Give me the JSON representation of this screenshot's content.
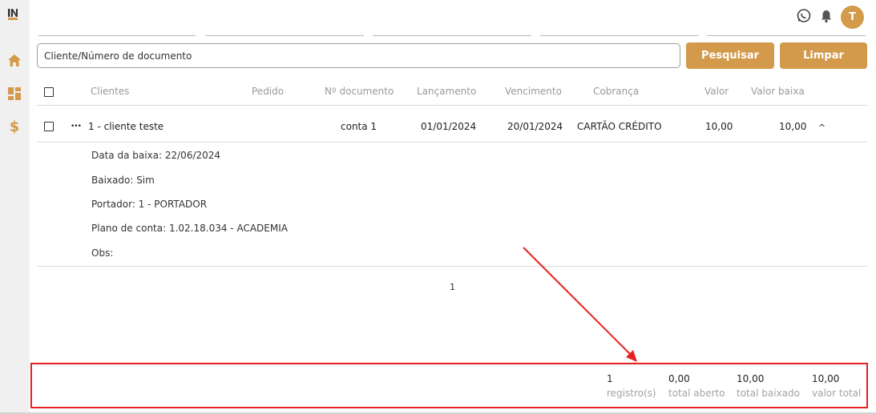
{
  "colors": {
    "accent": "#d39a4c",
    "highlight": "#e52020"
  },
  "sidebar": {
    "logo": "IN",
    "items": [
      {
        "icon": "home-icon"
      },
      {
        "icon": "dashboard-icon"
      },
      {
        "icon": "dollar-icon"
      }
    ],
    "dollar_glyph": "$"
  },
  "topbar": {
    "avatar_letter": "T"
  },
  "search": {
    "placeholder": "Cliente/Número de documento",
    "search_label": "Pesquisar",
    "clear_label": "Limpar"
  },
  "table": {
    "headers": [
      "Clientes",
      "Pedido",
      "Nº documento",
      "Lançamento",
      "Vencimento",
      "Cobrança",
      "Valor",
      "Valor baixa"
    ],
    "row": {
      "menu": "•••",
      "cliente": "1 - cliente teste",
      "pedido": "",
      "documento": "conta 1",
      "lancamento": "01/01/2024",
      "vencimento": "20/01/2024",
      "cobranca": "CARTÃO CRÉDITO",
      "valor": "10,00",
      "valor_baixa": "10,00",
      "expand": "^"
    },
    "details": [
      "Data da baixa: 22/06/2024",
      "Baixado: Sim",
      "Portador: 1 - PORTADOR",
      "Plano de conta: 1.02.18.034 - ACADEMIA",
      "Obs:"
    ]
  },
  "pagination": {
    "page": "1"
  },
  "footer": [
    {
      "value": "1",
      "label": "registro(s)"
    },
    {
      "value": "0,00",
      "label": "total aberto"
    },
    {
      "value": "10,00",
      "label": "total baixado"
    },
    {
      "value": "10,00",
      "label": "valor total"
    }
  ]
}
